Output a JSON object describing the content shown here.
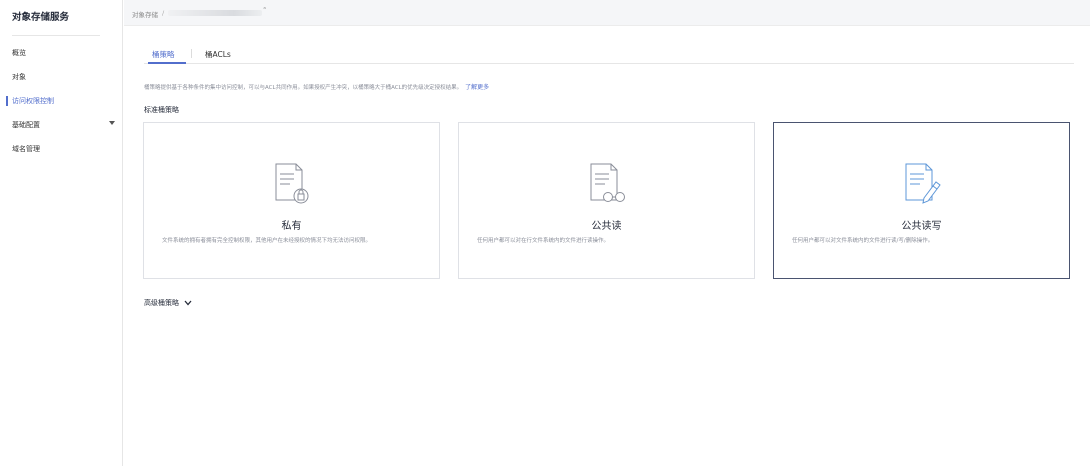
{
  "sidebar": {
    "title": "对象存储服务",
    "items": [
      {
        "label": "概览"
      },
      {
        "label": "对象"
      },
      {
        "label": "访问权限控制"
      },
      {
        "label": "基础配置"
      },
      {
        "label": "域名管理"
      }
    ]
  },
  "breadcrumb": {
    "root": "对象存储",
    "separator": "/",
    "marker": "˜"
  },
  "tabs": [
    {
      "label": "桶策略"
    },
    {
      "label": "桶ACLs"
    }
  ],
  "description": {
    "text": "桶策略提供基于各种条件的集中访问控制，可以与ACL共同作用。如果授权产生冲突，以桶策略大于桶ACL的优先级决定授权结果。",
    "link": "了解更多"
  },
  "standard_section": {
    "title": "标准桶策略"
  },
  "cards": [
    {
      "title": "私有",
      "description": "文件系统的拥有者拥有完全控制权限，其他用户在未经授权的情况下均无法访问权限。",
      "icon": "private-lock-icon"
    },
    {
      "title": "公共读",
      "description": "任何用户都可以对在行文件系统内的文件进行读操作。",
      "icon": "public-read-glasses-icon"
    },
    {
      "title": "公共读写",
      "description": "任何用户都可以对文件系统内的文件进行读/写/删除操作。",
      "icon": "public-read-write-pen-icon",
      "selected": true
    }
  ],
  "advanced": {
    "label": "高级桶策略"
  },
  "colors": {
    "accent": "#526ecc",
    "selected_border": "#4a5470",
    "icon_gray": "#8a8e99",
    "icon_blue": "#5e97d8"
  }
}
